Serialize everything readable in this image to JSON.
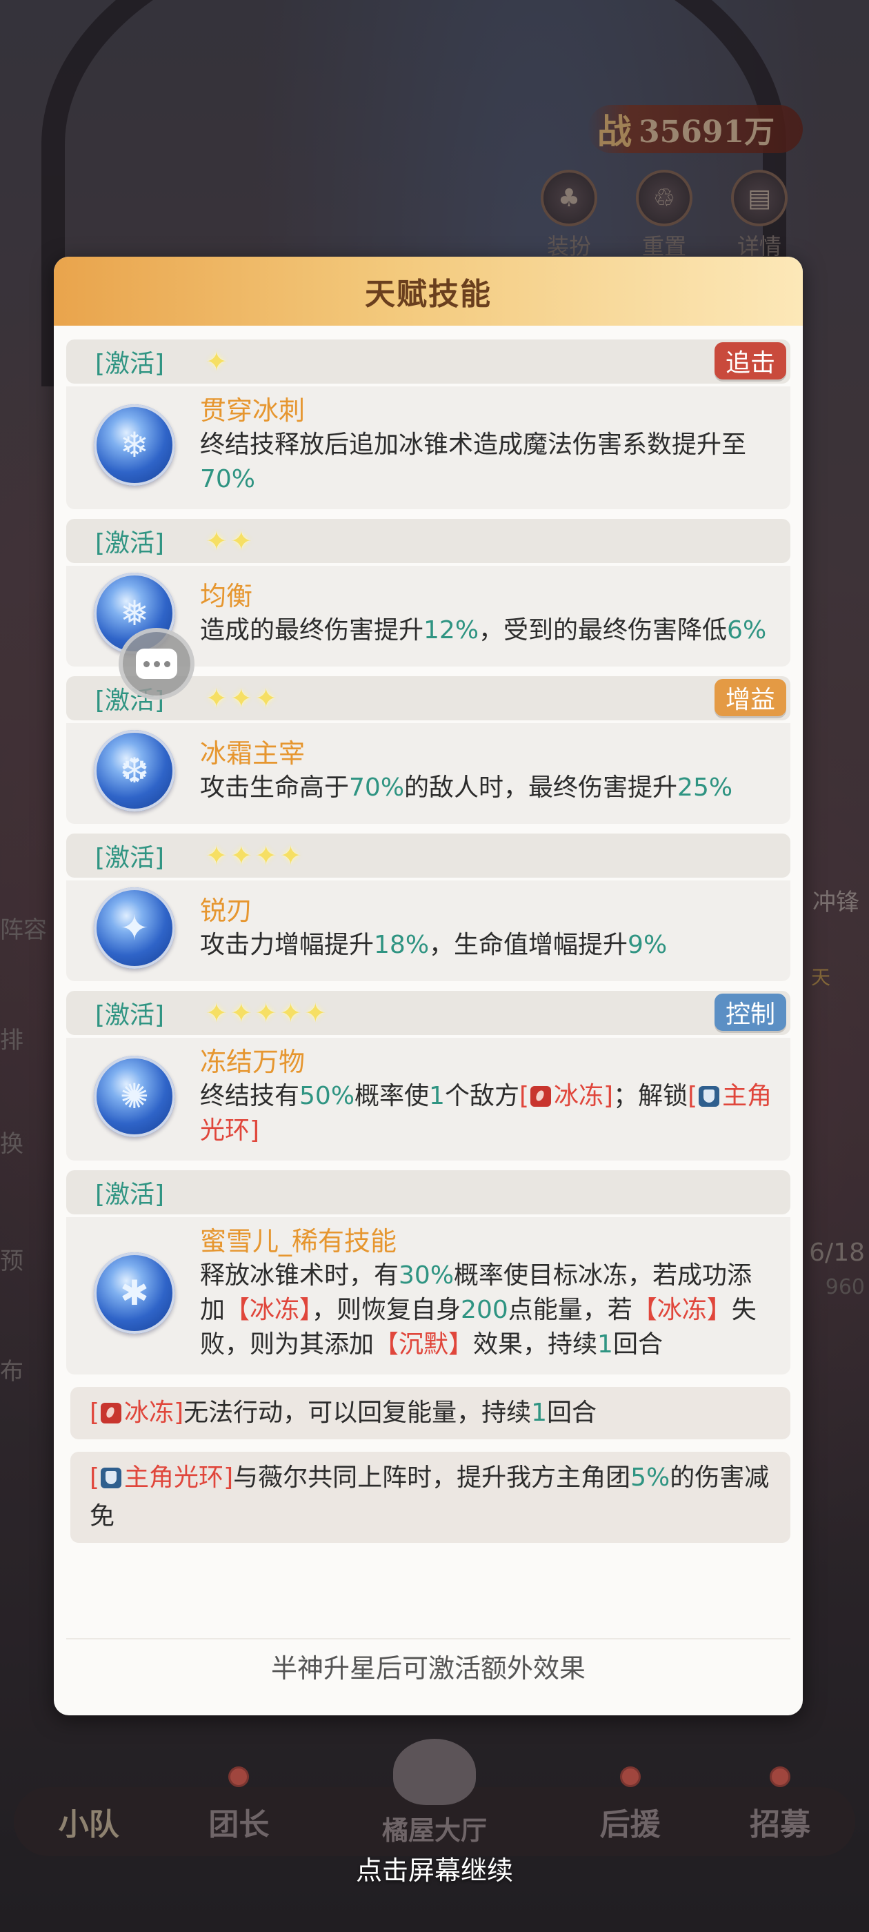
{
  "background": {
    "power_prefix": "战",
    "power_value": "35691万",
    "top_buttons": [
      {
        "label": "装扮",
        "icon": "outfit-icon"
      },
      {
        "label": "重置",
        "icon": "reset-icon"
      },
      {
        "label": "详情",
        "icon": "book-icon"
      }
    ],
    "left_labels": [
      "阵容",
      "排",
      "换",
      "预",
      "布"
    ],
    "right_labels": [
      "冲锋",
      "天",
      "6/18",
      "960"
    ]
  },
  "dialog": {
    "title": "天赋技能",
    "skills": [
      {
        "activate": "[激活]",
        "stars": 1,
        "tag": "追击",
        "tag_color": "#c94a3c",
        "name": "贯穿冰刺",
        "desc_parts": [
          "终结技释放后追加冰锥术造成魔法伤害系数提升至",
          "70%"
        ]
      },
      {
        "activate": "[激活]",
        "stars": 2,
        "tag": "",
        "tag_color": "",
        "name": "均衡",
        "desc_parts": [
          "造成的最终伤害提升",
          "12%",
          "，受到的最终伤害降低",
          "6%"
        ]
      },
      {
        "activate": "[激活]",
        "stars": 3,
        "tag": "增益",
        "tag_color": "#e49a44",
        "name": "冰霜主宰",
        "desc_parts": [
          "攻击生命高于",
          "70%",
          "的敌人时，最终伤害提升",
          "25%"
        ]
      },
      {
        "activate": "[激活]",
        "stars": 4,
        "tag": "",
        "tag_color": "",
        "name": "锐刃",
        "desc_parts": [
          "攻击力增幅提升",
          "18%",
          "，生命值增幅提升",
          "9%"
        ]
      },
      {
        "activate": "[激活]",
        "stars": 5,
        "tag": "控制",
        "tag_color": "#5b8fc4",
        "name": "冻结万物",
        "desc_parts": [
          "终结技有",
          "50%",
          "概率使",
          "1",
          "个敌方",
          "[",
          "冰冻",
          "]",
          "；解锁",
          "[",
          "主角光环",
          "]"
        ]
      },
      {
        "activate": "[激活]",
        "stars": 0,
        "tag": "",
        "tag_color": "",
        "name": "蜜雪儿_稀有技能",
        "desc_parts": [
          "释放冰锥术时，有",
          "30%",
          "概率使目标冰冻，若成功添加",
          "【冰冻】",
          "，则恢复自身",
          "200",
          "点能量，若",
          "【冰冻】",
          "失败，则为其添加",
          "【沉默】",
          "效果，持续",
          "1",
          "回合"
        ]
      }
    ],
    "notes": [
      {
        "parts": [
          "[",
          "冰冻",
          "]",
          "无法行动，可以回复能量，持续",
          "1",
          "回合"
        ]
      },
      {
        "parts": [
          "[",
          "主角光环",
          "]",
          "与薇尔共同上阵时，提升我方主角团",
          "5%",
          "的伤害减免"
        ]
      }
    ],
    "footer": "半神升星后可激活额外效果"
  },
  "bottom_nav": {
    "items": [
      "小队",
      "团长",
      "后援",
      "招募"
    ],
    "center_label": "橘屋大厅",
    "continue_hint": "点击屏幕继续"
  },
  "colors": {
    "header_gradient_start": "#e9a44c",
    "header_gradient_end": "#fce8b8",
    "highlight_green": "#2f9482",
    "highlight_red": "#e0463b",
    "skill_name_orange": "#e6962f",
    "star_yellow": "#f6df64"
  }
}
